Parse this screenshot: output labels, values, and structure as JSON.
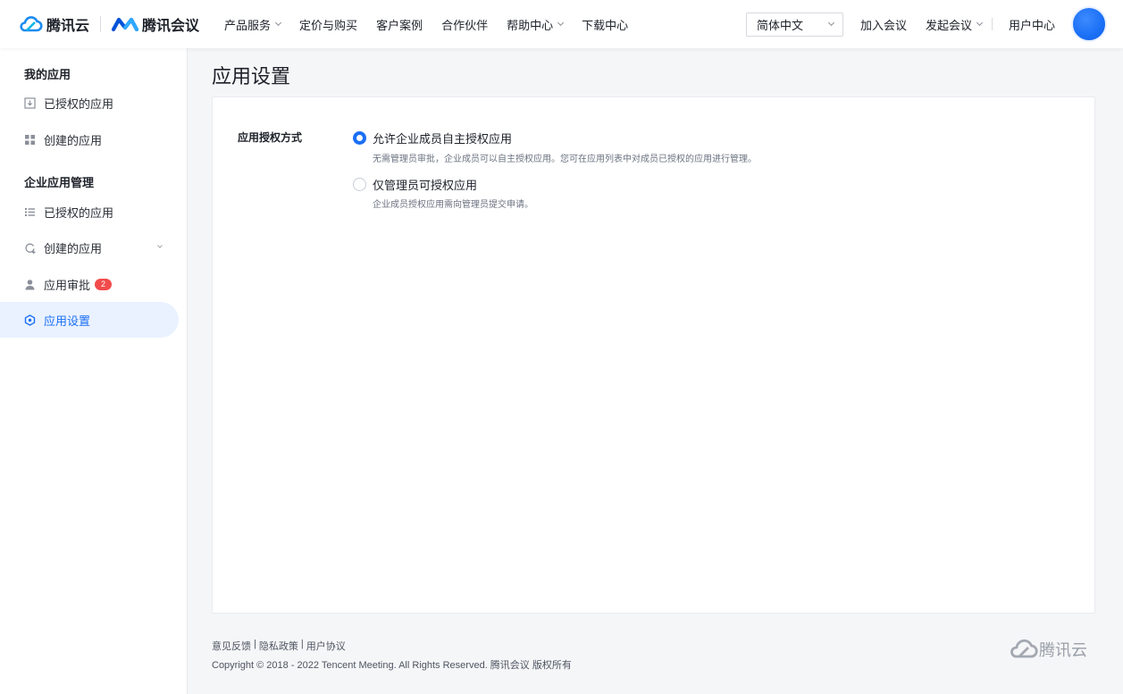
{
  "header": {
    "brand_cloud": "腾讯云",
    "brand_meeting": "腾讯会议",
    "nav": [
      {
        "label": "产品服务",
        "has_dropdown": true
      },
      {
        "label": "定价与购买",
        "has_dropdown": false
      },
      {
        "label": "客户案例",
        "has_dropdown": false
      },
      {
        "label": "合作伙伴",
        "has_dropdown": false
      },
      {
        "label": "帮助中心",
        "has_dropdown": true
      },
      {
        "label": "下载中心",
        "has_dropdown": false
      }
    ],
    "language": "简体中文",
    "join_meeting": "加入会议",
    "start_meeting": "发起会议",
    "user_center": "用户中心"
  },
  "sidebar": {
    "group_my": "我的应用",
    "my_items": [
      {
        "label": "已授权的应用",
        "icon": "download-box-icon"
      },
      {
        "label": "创建的应用",
        "icon": "grid-icon"
      }
    ],
    "group_enterprise": "企业应用管理",
    "enterprise_items": [
      {
        "label": "已授权的应用",
        "icon": "list-icon"
      },
      {
        "label": "创建的应用",
        "icon": "refresh-add-icon",
        "expandable": true
      },
      {
        "label": "应用审批",
        "icon": "user-icon",
        "badge": "2"
      },
      {
        "label": "应用设置",
        "icon": "settings-hexagon-icon",
        "active": true
      }
    ]
  },
  "main": {
    "title": "应用设置",
    "field_label": "应用授权方式",
    "options": [
      {
        "label": "允许企业成员自主授权应用",
        "desc": "无需管理员审批，企业成员可以自主授权应用。您可在应用列表中对成员已授权的应用进行管理。",
        "selected": true
      },
      {
        "label": "仅管理员可授权应用",
        "desc": "企业成员授权应用需向管理员提交申请。",
        "selected": false
      }
    ]
  },
  "footer": {
    "links": [
      "意见反馈",
      "隐私政策",
      "用户协议"
    ],
    "separator": "|",
    "copyright": "Copyright © 2018 - 2022 Tencent Meeting. All Rights Reserved. 腾讯会议 版权所有",
    "logo_text": "腾讯云"
  },
  "colors": {
    "accent": "#1b6ff5",
    "badge": "#f24b4b",
    "active_bg": "#eaf2ff"
  }
}
